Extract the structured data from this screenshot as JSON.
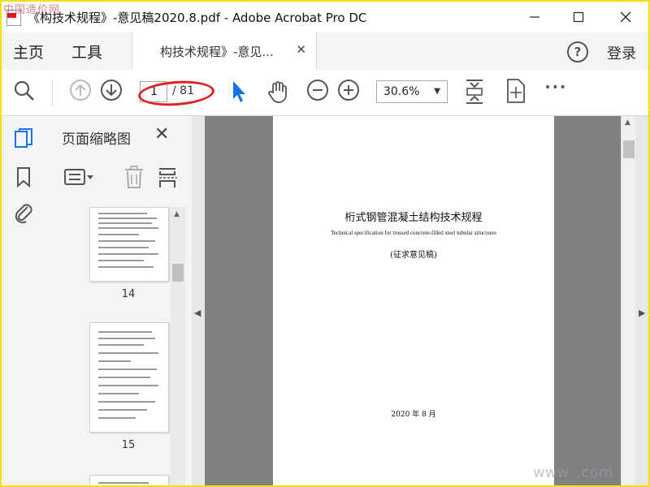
{
  "window": {
    "title": "《构技术规程》-意见稿2020.8.pdf - Adobe Acrobat Pro DC",
    "watermark_top": "中国造价网",
    "watermark_bottom": "www.        .com"
  },
  "nav": {
    "home": "主页",
    "tools": "工具",
    "doc_tab": "构技术规程》-意见...",
    "login": "登录",
    "help": "?"
  },
  "toolbar": {
    "current_page": "1",
    "total_pages": "/ 81",
    "zoom": "30.6%",
    "more": "•••"
  },
  "thumbnails": {
    "panel_title": "页面缩略图",
    "items": [
      {
        "label": "14"
      },
      {
        "label": "15"
      }
    ]
  },
  "document": {
    "title": "桁式钢管混凝土结构技术规程",
    "subtitle": "Technical specification for trussed concrete-filled steel tubular structures",
    "note": "(征求意见稿)",
    "date": "2020 年 8 月"
  },
  "colors": {
    "highlight_ellipse": "#e0231f",
    "accent": "#1473e6",
    "frame_border": "#f5dc1c"
  }
}
